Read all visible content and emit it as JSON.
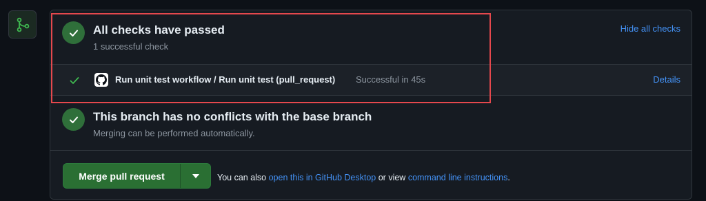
{
  "checks": {
    "title": "All checks have passed",
    "subtitle": "1 successful check",
    "hide_link": "Hide all checks"
  },
  "check_item": {
    "name": "Run unit test workflow / Run unit test (pull_request)",
    "status": "Successful in 45s",
    "details_link": "Details"
  },
  "conflicts": {
    "title": "This branch has no conflicts with the base branch",
    "subtitle": "Merging can be performed automatically."
  },
  "merge": {
    "button_label": "Merge pull request",
    "note_prefix": "You can also",
    "desktop_link": "open this in GitHub Desktop",
    "note_middle": "or view",
    "cli_link": "command line instructions",
    "note_suffix": "."
  },
  "colors": {
    "success": "#2f6f3a",
    "link": "#4493f8",
    "highlight": "#e5484d"
  },
  "icons": {
    "merge_status": "git-merge-icon",
    "check": "check-icon",
    "github": "github-logo-icon",
    "caret": "triangle-down-icon"
  }
}
